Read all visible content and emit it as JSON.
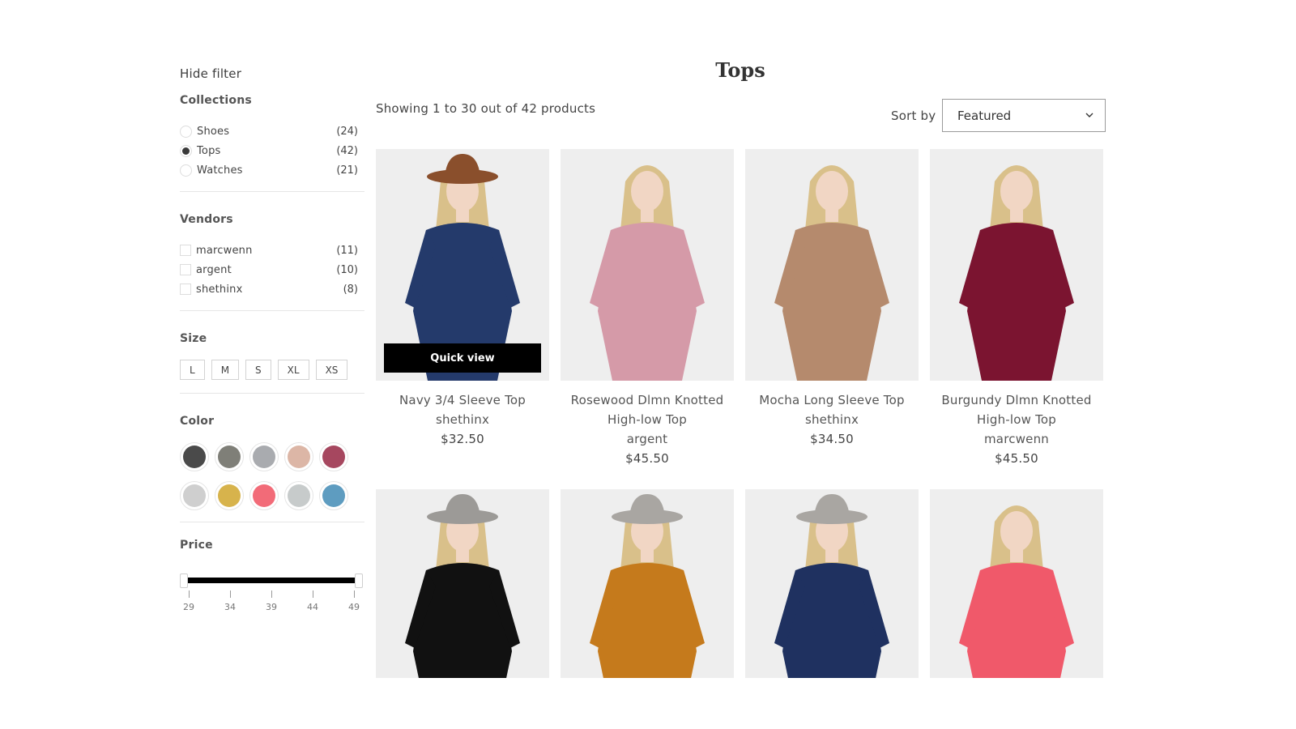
{
  "filters": {
    "hide_label": "Hide filter",
    "collections": {
      "title": "Collections",
      "items": [
        {
          "label": "Shoes",
          "count": "(24)",
          "checked": false
        },
        {
          "label": "Tops",
          "count": "(42)",
          "checked": true
        },
        {
          "label": "Watches",
          "count": "(21)",
          "checked": false
        }
      ]
    },
    "vendors": {
      "title": "Vendors",
      "items": [
        {
          "label": "marcwenn",
          "count": "(11)"
        },
        {
          "label": "argent",
          "count": "(10)"
        },
        {
          "label": "shethinx",
          "count": "(8)"
        }
      ]
    },
    "size": {
      "title": "Size",
      "options": [
        "L",
        "M",
        "S",
        "XL",
        "XS"
      ]
    },
    "color": {
      "title": "Color",
      "swatches": [
        "#4a4a4a",
        "#7f7f78",
        "#a9abaf",
        "#dcb6a6",
        "#a6475f",
        "#cfcfcf",
        "#d7b34c",
        "#f26b78",
        "#c7cbcb",
        "#5e9cc0"
      ]
    },
    "price": {
      "title": "Price",
      "min": 29,
      "max": 49,
      "ticks": [
        "29",
        "34",
        "39",
        "44",
        "49"
      ]
    }
  },
  "main": {
    "title": "Tops",
    "results_text": "Showing 1 to 30 out of 42 products",
    "sort_label": "Sort by",
    "sort_value": "Featured",
    "quick_view_label": "Quick view",
    "products": [
      {
        "name_line1": "Navy 3/4 Sleeve Top",
        "name_line2": "",
        "vendor": "shethinx",
        "price": "$32.50",
        "garment_color": "#243a6b",
        "hat": "#8a4f2c"
      },
      {
        "name_line1": "Rosewood Dlmn Knotted",
        "name_line2": "High-low Top",
        "vendor": "argent",
        "price": "$45.50",
        "garment_color": "#d59aa8",
        "hat": ""
      },
      {
        "name_line1": "Mocha Long Sleeve Top",
        "name_line2": "",
        "vendor": "shethinx",
        "price": "$34.50",
        "garment_color": "#b58a6d",
        "hat": ""
      },
      {
        "name_line1": "Burgundy Dlmn Knotted",
        "name_line2": "High-low Top",
        "vendor": "marcwenn",
        "price": "$45.50",
        "garment_color": "#7b1430",
        "hat": ""
      },
      {
        "garment_color": "#111111",
        "hat": "#9c9a97"
      },
      {
        "garment_color": "#c57a1c",
        "hat": "#a9a6a2"
      },
      {
        "garment_color": "#1f3160",
        "hat": "#a9a6a2"
      },
      {
        "garment_color": "#f0596a",
        "hat": ""
      }
    ]
  },
  "colors": {
    "accent": "#000000",
    "text": "#3d3d3d",
    "border": "#e6e6e6"
  }
}
